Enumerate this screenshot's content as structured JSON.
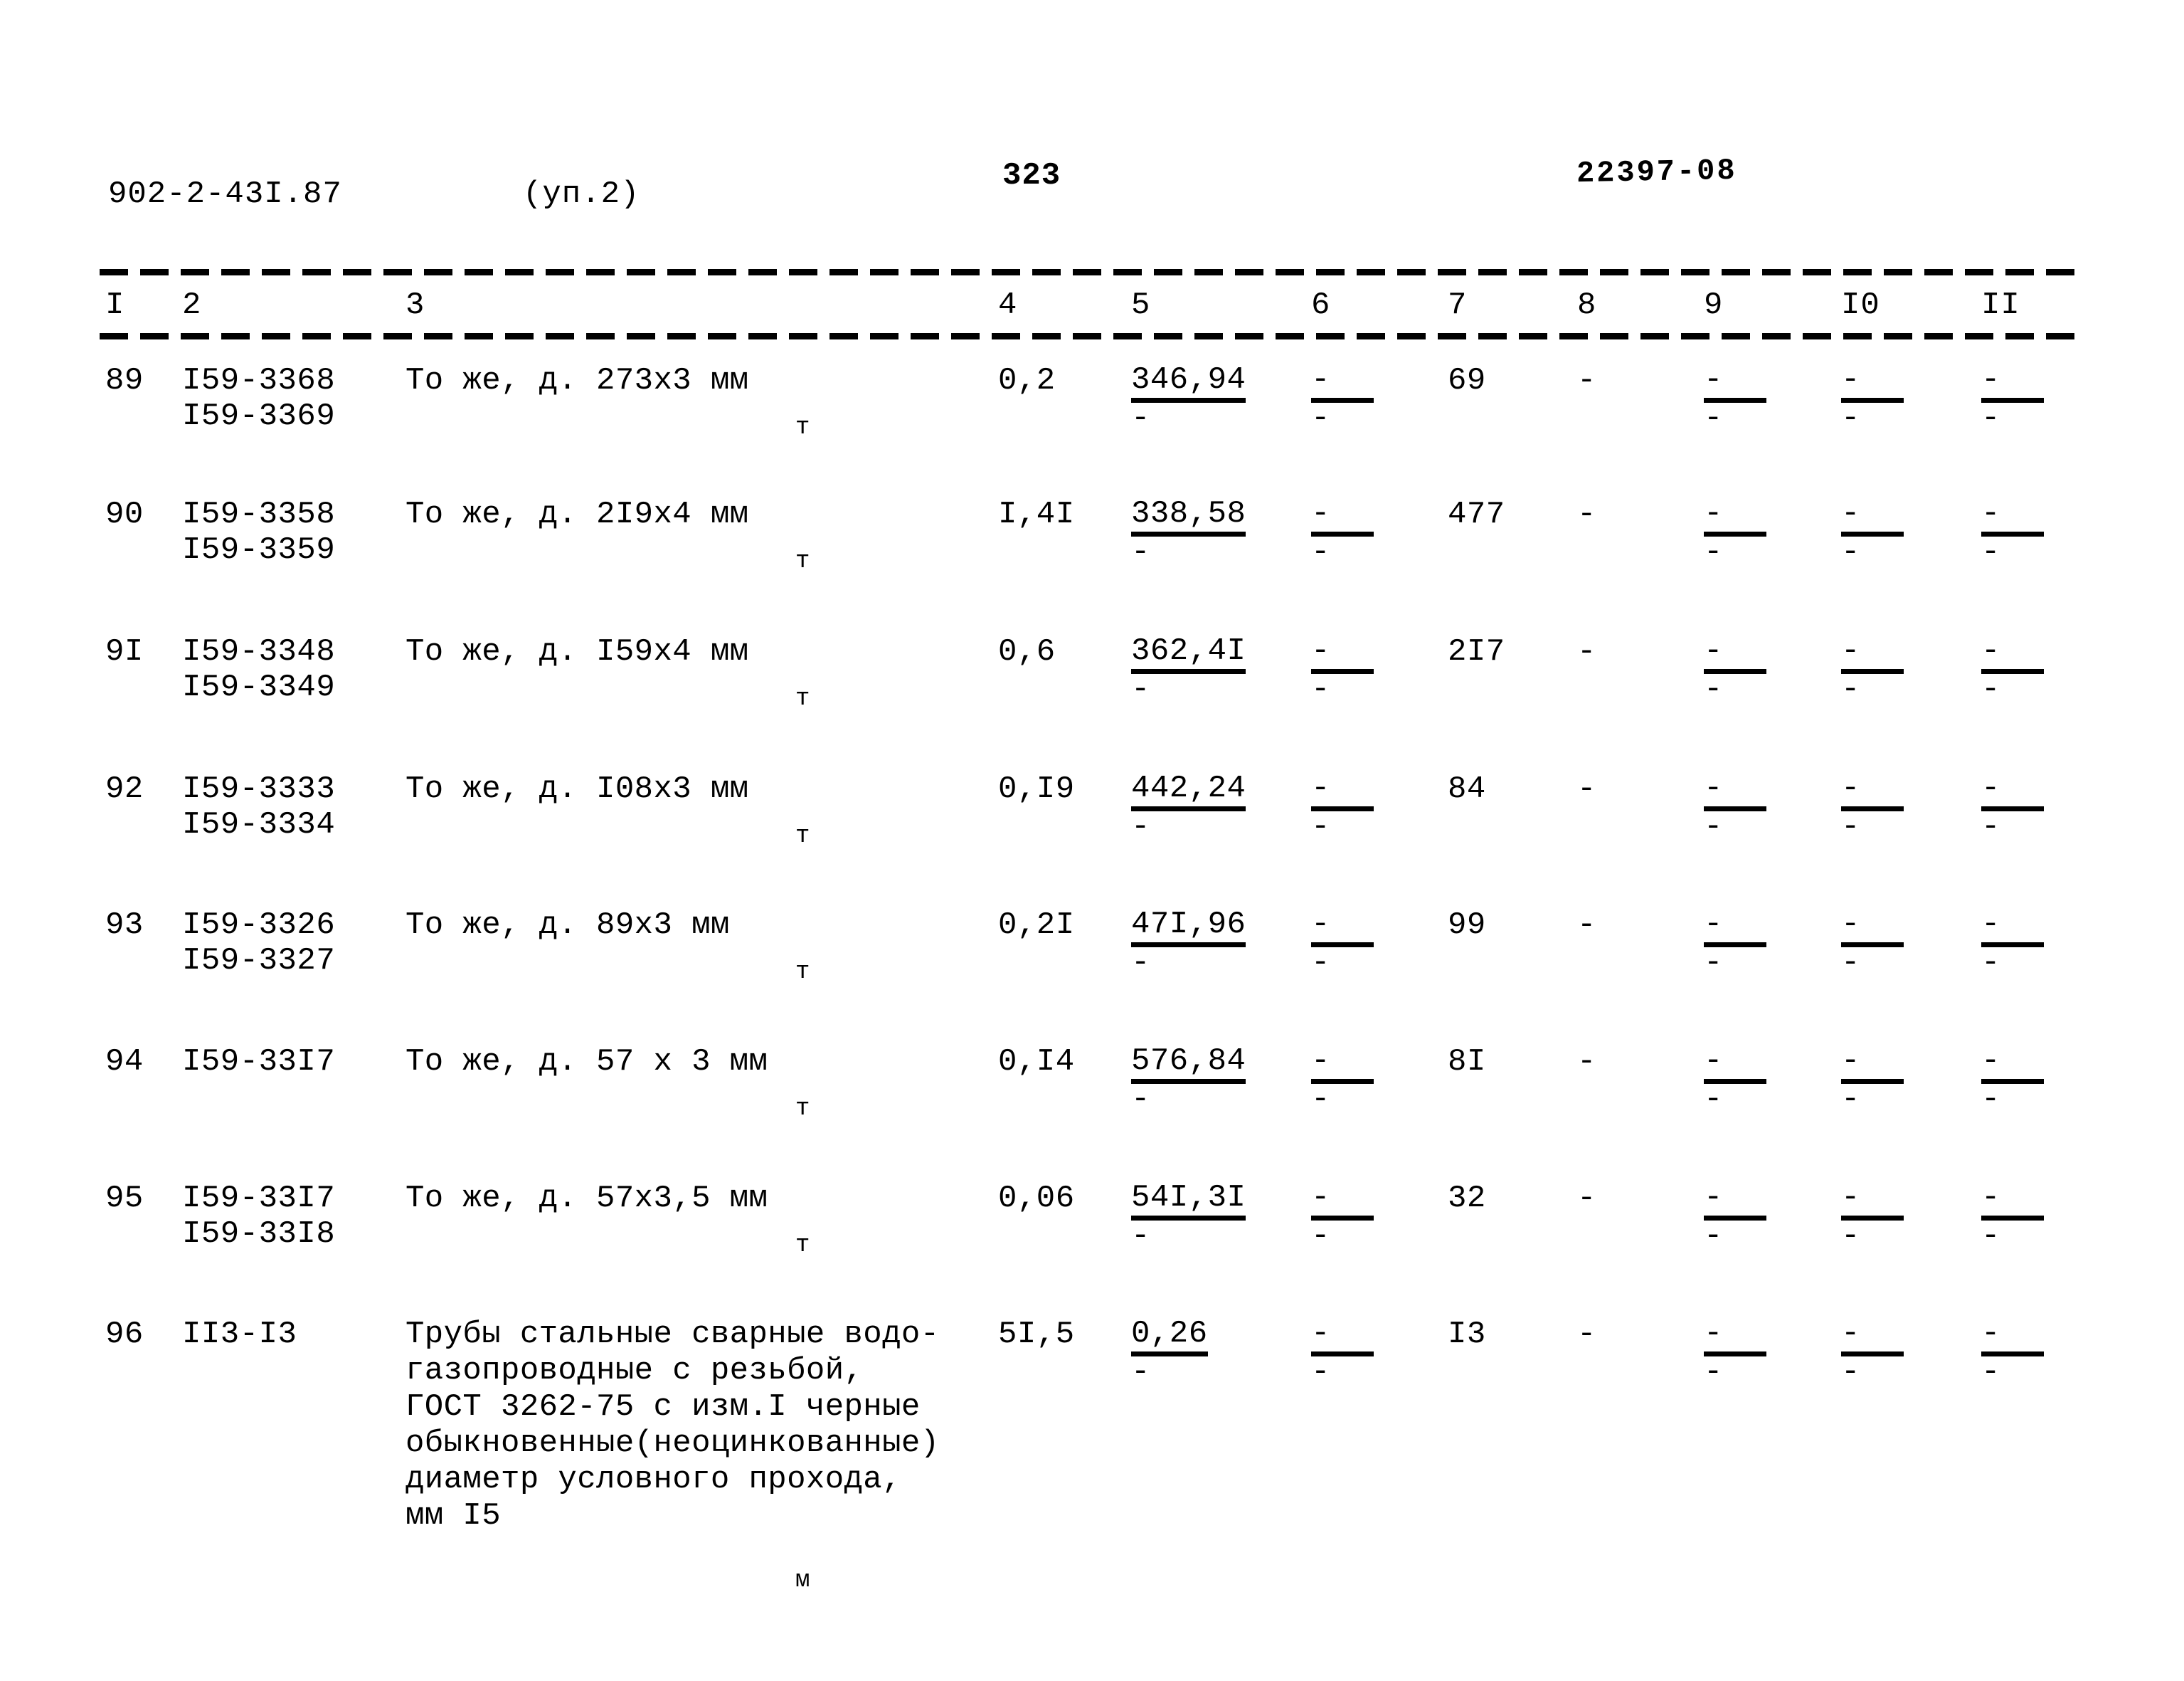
{
  "header": {
    "doc_code": "902-2-43I.87",
    "sub_label": "(уп.2)",
    "page_number": "323",
    "stamp": "22397-08"
  },
  "table": {
    "column_headers": [
      "I",
      "2",
      "3",
      "4",
      "5",
      "6",
      "7",
      "8",
      "9",
      "I0",
      "II"
    ],
    "rows": [
      {
        "num": "89",
        "code_line1": "I59-3368",
        "code_line2": "I59-3369",
        "desc": "То же, д. 273х3 мм",
        "unit": "т",
        "qty": "0,2",
        "c5_top": "346,94",
        "c5_bot": "-",
        "c6_top": "-",
        "c6_bot": "-",
        "c7": "69",
        "c8": "-",
        "c9_top": "-",
        "c9_bot": "-",
        "c10_top": "-",
        "c10_bot": "-",
        "c11_top": "-",
        "c11_bot": "-"
      },
      {
        "num": "90",
        "code_line1": "I59-3358",
        "code_line2": "I59-3359",
        "desc": "То же, д. 2I9х4 мм",
        "unit": "т",
        "qty": "I,4I",
        "c5_top": "338,58",
        "c5_bot": "-",
        "c6_top": "-",
        "c6_bot": "-",
        "c7": "477",
        "c8": "-",
        "c9_top": "-",
        "c9_bot": "-",
        "c10_top": "-",
        "c10_bot": "-",
        "c11_top": "-",
        "c11_bot": "-"
      },
      {
        "num": "9I",
        "code_line1": "I59-3348",
        "code_line2": "I59-3349",
        "desc": "То же, д. I59х4 мм",
        "unit": "т",
        "qty": "0,6",
        "c5_top": "362,4I",
        "c5_bot": "-",
        "c6_top": "-",
        "c6_bot": "-",
        "c7": "2I7",
        "c8": "-",
        "c9_top": "-",
        "c9_bot": "-",
        "c10_top": "-",
        "c10_bot": "-",
        "c11_top": "-",
        "c11_bot": "-"
      },
      {
        "num": "92",
        "code_line1": "I59-3333",
        "code_line2": "I59-3334",
        "desc": "То же, д. I08х3 мм",
        "unit": "т",
        "qty": "0,I9",
        "c5_top": "442,24",
        "c5_bot": "-",
        "c6_top": "-",
        "c6_bot": "-",
        "c7": "84",
        "c8": "-",
        "c9_top": "-",
        "c9_bot": "-",
        "c10_top": "-",
        "c10_bot": "-",
        "c11_top": "-",
        "c11_bot": "-"
      },
      {
        "num": "93",
        "code_line1": "I59-3326",
        "code_line2": "I59-3327",
        "desc": "То же, д. 89х3 мм",
        "unit": "т",
        "qty": "0,2I",
        "c5_top": "47I,96",
        "c5_bot": "-",
        "c6_top": "-",
        "c6_bot": "-",
        "c7": "99",
        "c8": "-",
        "c9_top": "-",
        "c9_bot": "-",
        "c10_top": "-",
        "c10_bot": "-",
        "c11_top": "-",
        "c11_bot": "-"
      },
      {
        "num": "94",
        "code_line1": "I59-33I7",
        "code_line2": "",
        "desc": "То же, д. 57 х 3 мм",
        "unit": "т",
        "qty": "0,I4",
        "c5_top": "576,84",
        "c5_bot": "-",
        "c6_top": "-",
        "c6_bot": "-",
        "c7": "8I",
        "c8": "-",
        "c9_top": "-",
        "c9_bot": "-",
        "c10_top": "-",
        "c10_bot": "-",
        "c11_top": "-",
        "c11_bot": "-"
      },
      {
        "num": "95",
        "code_line1": "I59-33I7",
        "code_line2": "I59-33I8",
        "desc": "То же, д. 57х3,5 мм",
        "unit": "т",
        "qty": "0,06",
        "c5_top": "54I,3I",
        "c5_bot": "-",
        "c6_top": "-",
        "c6_bot": "-",
        "c7": "32",
        "c8": "-",
        "c9_top": "-",
        "c9_bot": "-",
        "c10_top": "-",
        "c10_bot": "-",
        "c11_top": "-",
        "c11_bot": "-"
      },
      {
        "num": "96",
        "code_line1": "II3-I3",
        "code_line2": "",
        "desc": "Трубы стальные сварные водо-\nгазопроводные с резьбой,\nГОСТ 3262-75 с изм.I черные\nобыкновенные(неоцинкованные)\nдиаметр условного прохода,\nмм I5",
        "unit": "м",
        "qty": "5I,5",
        "c5_top": "0,26",
        "c5_bot": "-",
        "c6_top": "-",
        "c6_bot": "-",
        "c7": "I3",
        "c8": "-",
        "c9_top": "-",
        "c9_bot": "-",
        "c10_top": "-",
        "c10_bot": "-",
        "c11_top": "-",
        "c11_bot": "-"
      }
    ]
  }
}
